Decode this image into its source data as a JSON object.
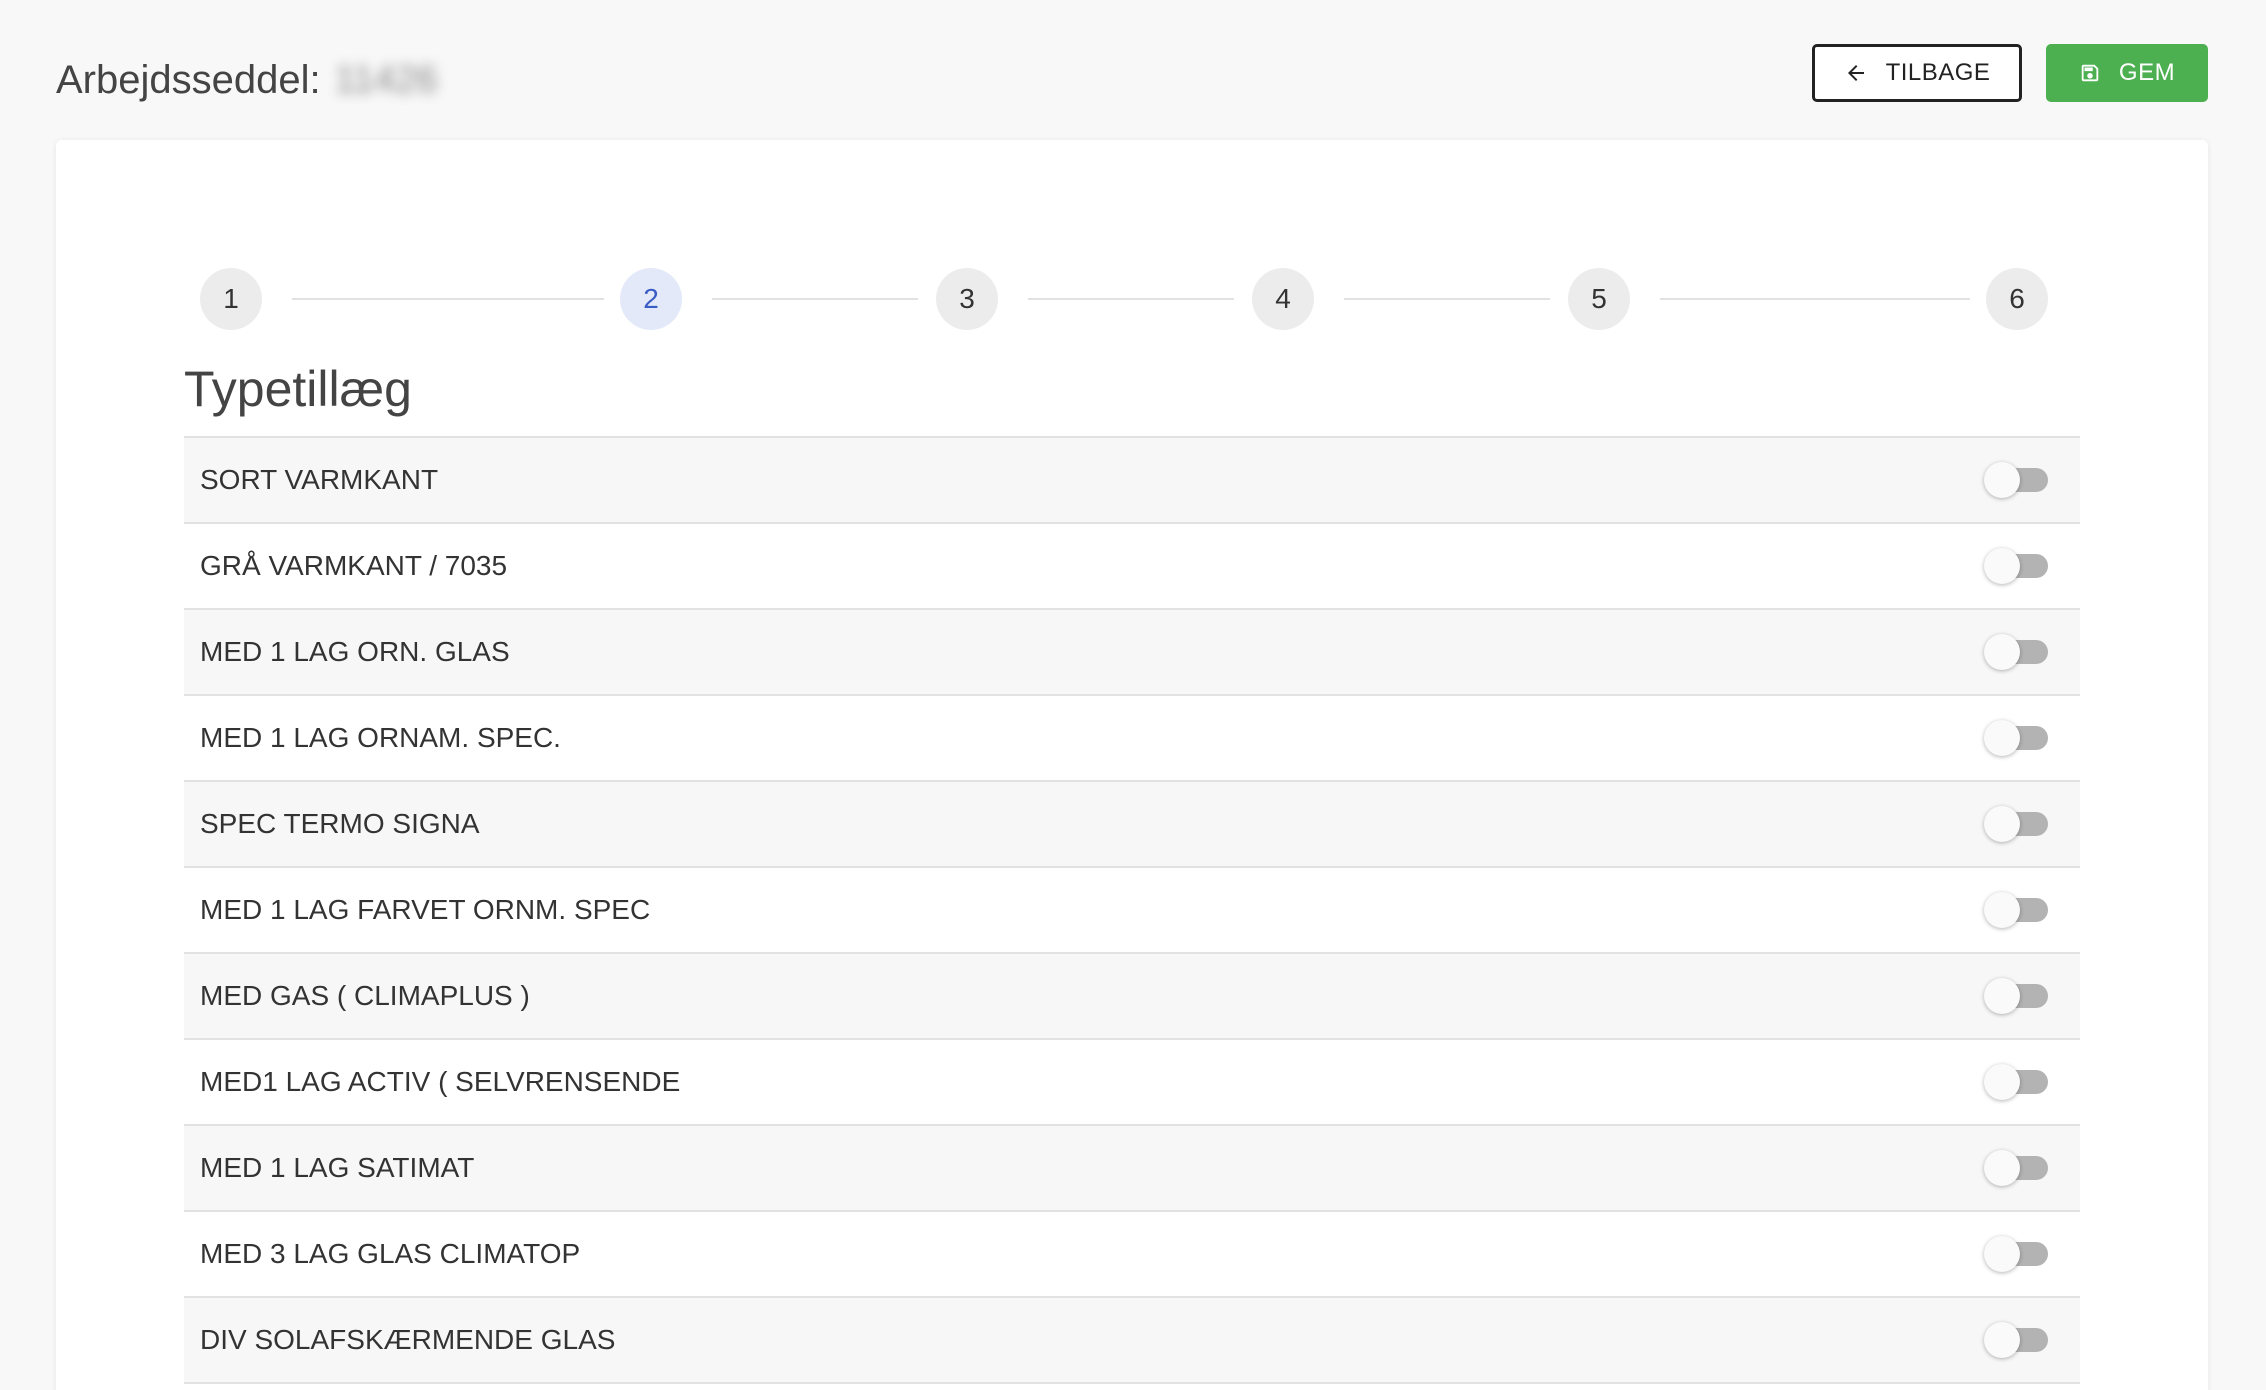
{
  "header": {
    "title": "Arbejdsseddel:",
    "title_id": "11426",
    "back_label": "TILBAGE",
    "save_label": "GEM"
  },
  "stepper": {
    "steps": [
      "1",
      "2",
      "3",
      "4",
      "5",
      "6"
    ],
    "active_step": "2"
  },
  "section": {
    "title": "Typetillæg"
  },
  "options": [
    {
      "label": "SORT VARMKANT",
      "enabled": false
    },
    {
      "label": "GRÅ VARMKANT / 7035",
      "enabled": false
    },
    {
      "label": "MED 1 LAG ORN. GLAS",
      "enabled": false
    },
    {
      "label": "MED 1 LAG ORNAM. SPEC.",
      "enabled": false
    },
    {
      "label": "SPEC TERMO SIGNA",
      "enabled": false
    },
    {
      "label": "MED 1 LAG FARVET ORNM. SPEC",
      "enabled": false
    },
    {
      "label": "MED GAS ( CLIMAPLUS )",
      "enabled": false
    },
    {
      "label": "MED1 LAG ACTIV ( SELVRENSENDE",
      "enabled": false
    },
    {
      "label": "MED 1 LAG SATIMAT",
      "enabled": false
    },
    {
      "label": "MED 3 LAG GLAS CLIMATOP",
      "enabled": false
    },
    {
      "label": "DIV SOLAFSKÆRMENDE GLAS",
      "enabled": false
    }
  ],
  "colors": {
    "save_button": "#4caf50",
    "active_step_bg": "#e3e9f8",
    "active_step_text": "#3b5cc4"
  }
}
